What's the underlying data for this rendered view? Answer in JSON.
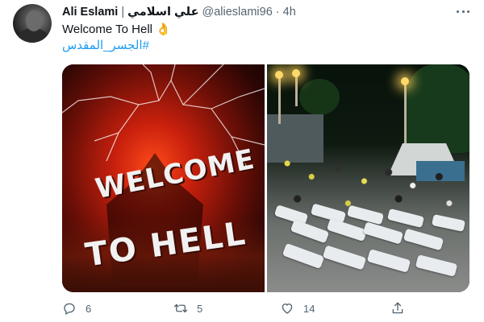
{
  "tweet": {
    "display_name": "Ali Eslami",
    "separator": "|",
    "display_name_arabic": "علي اسلامي",
    "handle": "@alieslami96",
    "dot": "·",
    "time": "4h",
    "text_line1": "Welcome To Hell",
    "emoji": "👌",
    "hashtag": "#الجسر_المقدس"
  },
  "media": {
    "left_image": {
      "words": [
        "WELCOME",
        "TO HELL"
      ],
      "palette": [
        "#ff4a1a",
        "#c8200d",
        "#2a0604"
      ]
    },
    "right_image": {
      "scene": "night-crowd-with-covered-bodies"
    }
  },
  "actions": {
    "reply": {
      "icon": "reply-icon",
      "count": "6"
    },
    "retweet": {
      "icon": "retweet-icon",
      "count": "5"
    },
    "like": {
      "icon": "heart-icon",
      "count": "14"
    },
    "share": {
      "icon": "share-icon"
    }
  },
  "colors": {
    "link": "#1d9bf0",
    "secondary_text": "#536471",
    "primary_text": "#0f1419"
  }
}
